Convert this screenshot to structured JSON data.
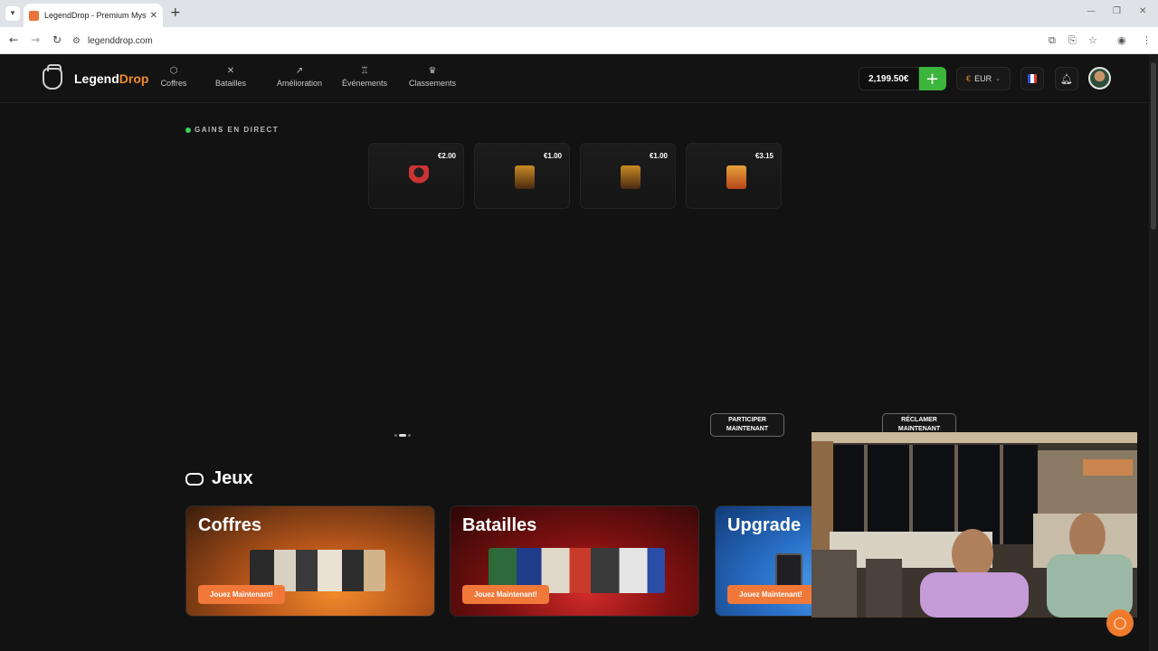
{
  "browser": {
    "tab_title": "LegendDrop - Premium Myster",
    "url": "legenddrop.com"
  },
  "header": {
    "logo_text_a": "Legend",
    "logo_text_b": "Drop",
    "nav": [
      {
        "label": "Coffres",
        "icon": "cube-icon"
      },
      {
        "label": "Batailles",
        "icon": "swords-icon"
      },
      {
        "label": "Amélioration",
        "icon": "trend-up-icon"
      },
      {
        "label": "Événements",
        "icon": "trophy-icon"
      },
      {
        "label": "Classements",
        "icon": "crown-icon"
      }
    ],
    "balance": "2,199.50€",
    "currency_symbol": "€",
    "currency": "EUR",
    "language_flag": "france-flag-icon"
  },
  "live": {
    "label": "GAINS EN DIRECT",
    "drops": [
      {
        "price": "€2.00",
        "item_icon": "anime-figure-icon"
      },
      {
        "price": "€1.00",
        "item_icon": "card-pack-icon"
      },
      {
        "price": "€1.00",
        "item_icon": "card-pack-icon"
      },
      {
        "price": "€3.15",
        "item_icon": "box-item-icon"
      }
    ]
  },
  "hero": {
    "participate_label": "PARTICIPER MAINTENANT",
    "claim_label": "RÉCLAMER MAINTENANT"
  },
  "games": {
    "title": "Jeux",
    "cards": [
      {
        "title": "Coffres",
        "button": "Jouez Maintenant!"
      },
      {
        "title": "Batailles",
        "button": "Jouez Maintenant!"
      },
      {
        "title": "Upgrade",
        "button": "Jouez Maintenant!"
      }
    ]
  },
  "colors": {
    "accent": "#f08c2a",
    "deposit": "#3bb53b",
    "live_dot": "#3bd15a",
    "play_button": "#f0793a"
  }
}
